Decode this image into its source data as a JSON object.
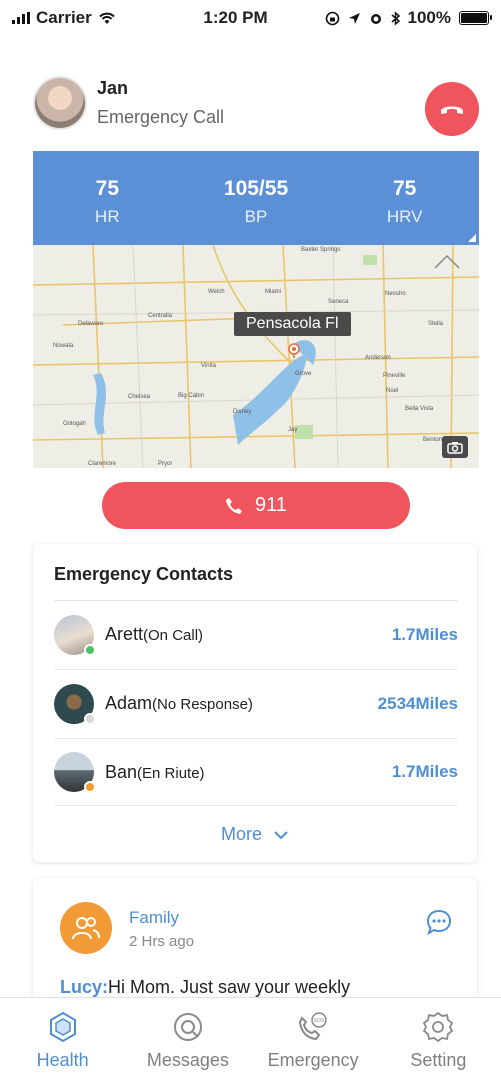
{
  "status_bar": {
    "carrier": "Carrier",
    "time": "1:20 PM",
    "battery": "100%"
  },
  "caller": {
    "name": "Jan",
    "subtitle": "Emergency Call"
  },
  "vitals": [
    {
      "value": "75",
      "label": "HR"
    },
    {
      "value": "105/55",
      "label": "BP"
    },
    {
      "value": "75",
      "label": "HRV"
    }
  ],
  "map": {
    "location_label": "Pensacola Fl",
    "place_names": [
      "Baxter Springs",
      "Welch",
      "Miami",
      "Seneca",
      "Neosho",
      "Delaware",
      "Centralia",
      "Stella",
      "Nowata",
      "Vinita",
      "Anderson",
      "Chelsea",
      "Big Cabin",
      "Pineville",
      "Noel",
      "Grove",
      "Oologah",
      "Disney",
      "Bella Vista",
      "Claremore",
      "Pryor",
      "Jay",
      "Bentonv"
    ]
  },
  "call_911": {
    "label": "911"
  },
  "emergency_contacts": {
    "title": "Emergency Contacts",
    "contacts": [
      {
        "name": "Arett",
        "status": "(On Call)",
        "distance": "1.7Miles",
        "status_color": "#4cc06a"
      },
      {
        "name": "Adam",
        "status": "(No Response)",
        "distance": "2534Miles",
        "status_color": "#d8d8d8"
      },
      {
        "name": "Ban",
        "status": "(En Riute)",
        "distance": "1.7Miles",
        "status_color": "#f29a35"
      }
    ],
    "more_label": "More"
  },
  "family": {
    "name": "Family",
    "time": "2 Hrs ago",
    "message_sender": "Lucy:",
    "message_text": "Hi Mom. Just saw your weekly"
  },
  "tabs": [
    {
      "label": "Health",
      "icon": "health-icon",
      "active": true
    },
    {
      "label": "Messages",
      "icon": "messages-icon",
      "active": false
    },
    {
      "label": "Emergency",
      "icon": "emergency-sos-icon",
      "active": false
    },
    {
      "label": "Setting",
      "icon": "gear-icon",
      "active": false
    }
  ],
  "colors": {
    "accent": "#4e8fd4",
    "danger": "#f0545d",
    "vitals_bg": "#5b8fd6",
    "family_orange": "#f29a35"
  }
}
